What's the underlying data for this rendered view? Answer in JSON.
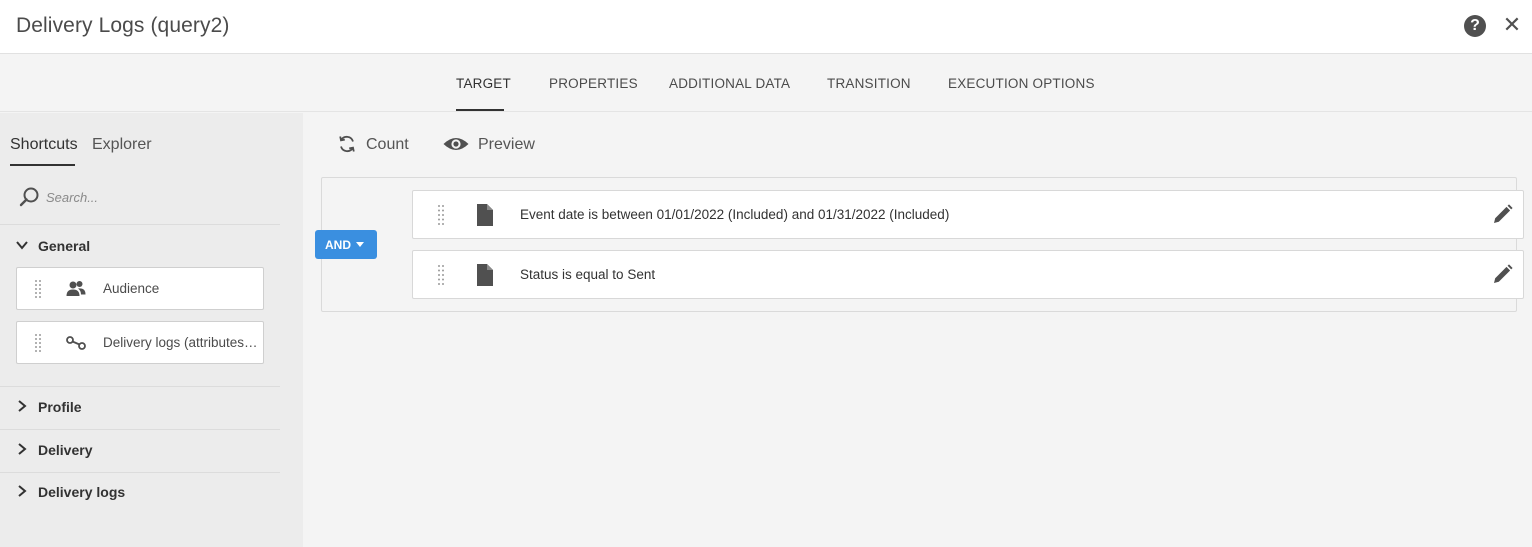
{
  "window": {
    "title": "Delivery Logs (query2)",
    "help_label": "?",
    "close_label": "✕"
  },
  "tabs": [
    {
      "label": "TARGET",
      "active": true
    },
    {
      "label": "PROPERTIES",
      "active": false
    },
    {
      "label": "ADDITIONAL DATA",
      "active": false
    },
    {
      "label": "TRANSITION",
      "active": false
    },
    {
      "label": "EXECUTION OPTIONS",
      "active": false
    }
  ],
  "sidebar": {
    "tabs": [
      {
        "label": "Shortcuts",
        "active": true
      },
      {
        "label": "Explorer",
        "active": false
      }
    ],
    "search": {
      "placeholder": "Search...",
      "value": ""
    },
    "groups": [
      {
        "label": "General",
        "expanded": true,
        "items": [
          {
            "label": "Audience",
            "icon": "audience-icon"
          },
          {
            "label": "Delivery logs (attributes…",
            "icon": "link-icon"
          }
        ]
      },
      {
        "label": "Profile",
        "expanded": false
      },
      {
        "label": "Delivery",
        "expanded": false
      },
      {
        "label": "Delivery logs",
        "expanded": false
      }
    ]
  },
  "toolbar": {
    "count_label": "Count",
    "preview_label": "Preview"
  },
  "conditions": {
    "operator_label": "AND",
    "items": [
      {
        "label": "Event date is between 01/01/2022 (Included) and 01/31/2022 (Included)"
      },
      {
        "label": "Status is equal to Sent"
      }
    ]
  },
  "colors": {
    "accent": "#3a8fe0",
    "title_bar": "#ffffff",
    "sidebar_bg": "#ececec",
    "main_bg": "#f4f4f4",
    "icon": "#505050"
  }
}
